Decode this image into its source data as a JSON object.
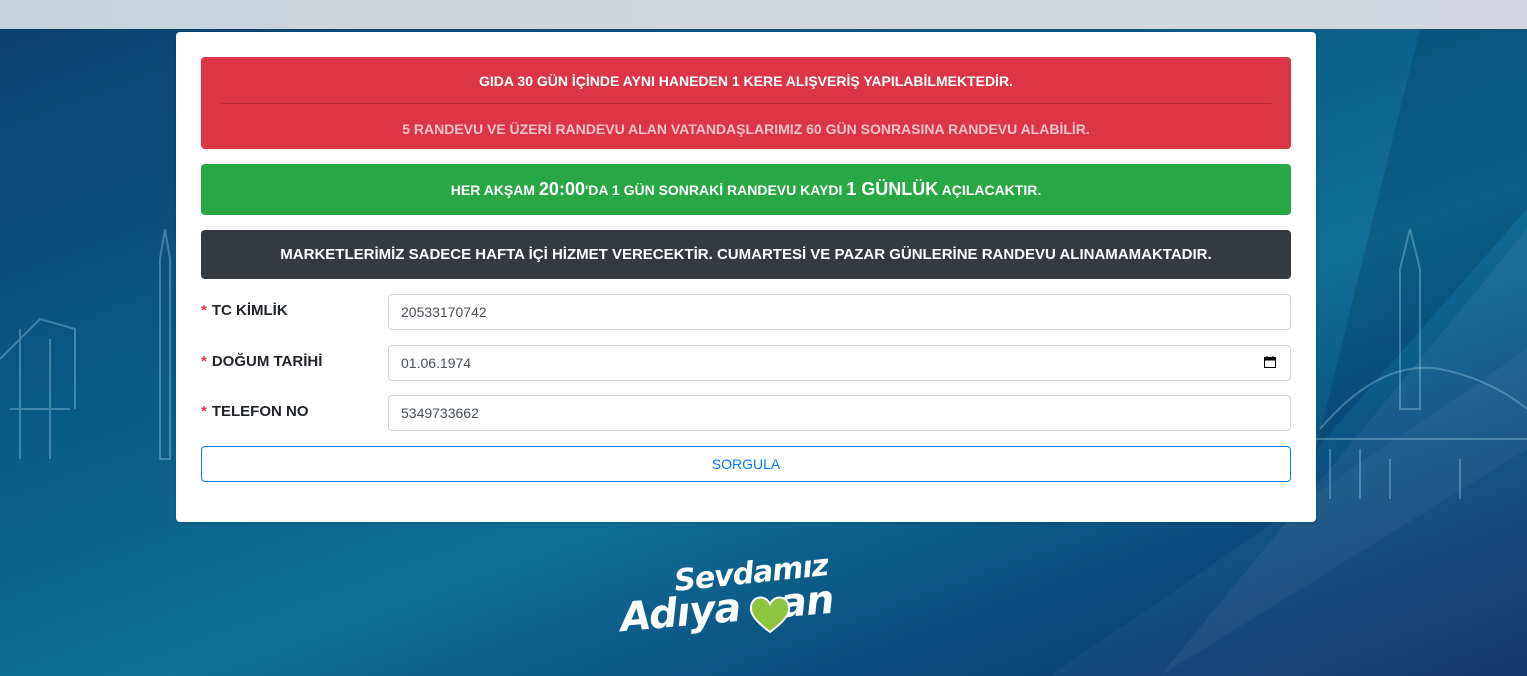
{
  "alerts": {
    "red_line1": "GIDA 30 GÜN İÇİNDE AYNI HANEDEN 1 KERE ALIŞVERİŞ YAPILABİLMEKTEDİR.",
    "red_line2": "5 RANDEVU VE ÜZERİ RANDEVU ALAN VATANDAŞLARIMIZ 60 GÜN SONRASINA RANDEVU ALABİLİR.",
    "green_part1": "HER AKŞAM ",
    "green_time": "20:00",
    "green_part2": "'DA 1 GÜN SONRAKİ RANDEVU KAYDI ",
    "green_duration": "1 GÜNLÜK",
    "green_part3": " AÇILACAKTIR.",
    "dark": "MARKETLERİMİZ SADECE HAFTA İÇİ HİZMET VERECEKTİR. CUMARTESİ VE PAZAR GÜNLERİNE RANDEVU ALINAMAMAKTADIR."
  },
  "form": {
    "required_mark": "*",
    "tc_label": "TC KİMLİK",
    "tc_value": "20533170742",
    "birth_label": "DOĞUM TARİHİ",
    "birth_value": "01.06.1974",
    "phone_label": "TELEFON NO",
    "phone_value": "5349733662",
    "submit_label": "SORGULA"
  },
  "logo": {
    "line1": "Sevdamız",
    "line2_a": "Adıya",
    "line2_b": "an"
  },
  "colors": {
    "danger": "#dc3545",
    "success": "#28a745",
    "dark": "#343a40",
    "primary": "#007bff",
    "logo_heart": "#8cc63f"
  },
  "icons": {
    "date_picker": "calendar-icon",
    "logo_heart": "heart-icon"
  }
}
